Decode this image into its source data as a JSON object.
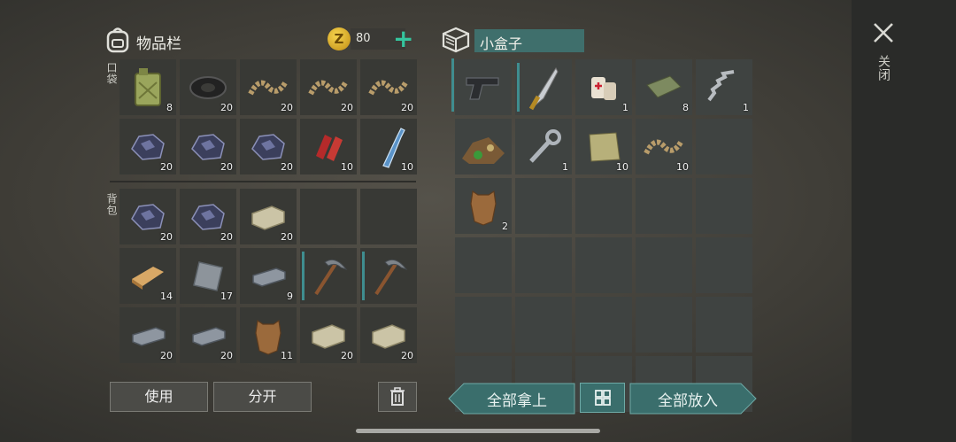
{
  "inventory": {
    "title": "物品栏",
    "coins": "80",
    "pocket_label": "口袋",
    "backpack_label": "背包",
    "use_label": "使用",
    "split_label": "分开"
  },
  "box": {
    "title": "小盒子"
  },
  "close_label": "关闭",
  "bottom": {
    "take_all": "全部拿上",
    "put_all": "全部放入"
  },
  "pocket_items": [
    {
      "name": "jerrycan",
      "count": "8"
    },
    {
      "name": "tire",
      "count": "20"
    },
    {
      "name": "rope",
      "count": "20"
    },
    {
      "name": "rope",
      "count": "20"
    },
    {
      "name": "rope",
      "count": "20"
    },
    {
      "name": "coal-ore",
      "count": "20"
    },
    {
      "name": "coal-ore",
      "count": "20"
    },
    {
      "name": "coal-ore",
      "count": "20"
    },
    {
      "name": "raw-meat",
      "count": "10"
    },
    {
      "name": "water-bottle",
      "count": "10"
    }
  ],
  "backpack_items": [
    {
      "name": "coal-ore",
      "count": "20"
    },
    {
      "name": "coal-ore",
      "count": "20"
    },
    {
      "name": "stone-block",
      "count": "20"
    },
    {
      "name": "",
      "count": ""
    },
    {
      "name": "",
      "count": ""
    },
    {
      "name": "wood-plank",
      "count": "14"
    },
    {
      "name": "iron-plate",
      "count": "17"
    },
    {
      "name": "iron-ingot",
      "count": "9"
    },
    {
      "name": "pickaxe",
      "count": ""
    },
    {
      "name": "pickaxe",
      "count": ""
    },
    {
      "name": "iron-ingot",
      "count": "20"
    },
    {
      "name": "iron-ingot",
      "count": "20"
    },
    {
      "name": "hide",
      "count": "11"
    },
    {
      "name": "stone-block",
      "count": "20"
    },
    {
      "name": "stone-block",
      "count": "20"
    }
  ],
  "box_items": [
    {
      "name": "pistol",
      "count": ""
    },
    {
      "name": "machete",
      "count": ""
    },
    {
      "name": "medkit",
      "count": "1"
    },
    {
      "name": "cloth",
      "count": "8"
    },
    {
      "name": "spring",
      "count": "1"
    },
    {
      "name": "food-pile",
      "count": ""
    },
    {
      "name": "wrench",
      "count": "1"
    },
    {
      "name": "burlap",
      "count": "10"
    },
    {
      "name": "rope",
      "count": "10"
    },
    {
      "name": "",
      "count": ""
    },
    {
      "name": "hide",
      "count": "2"
    }
  ]
}
